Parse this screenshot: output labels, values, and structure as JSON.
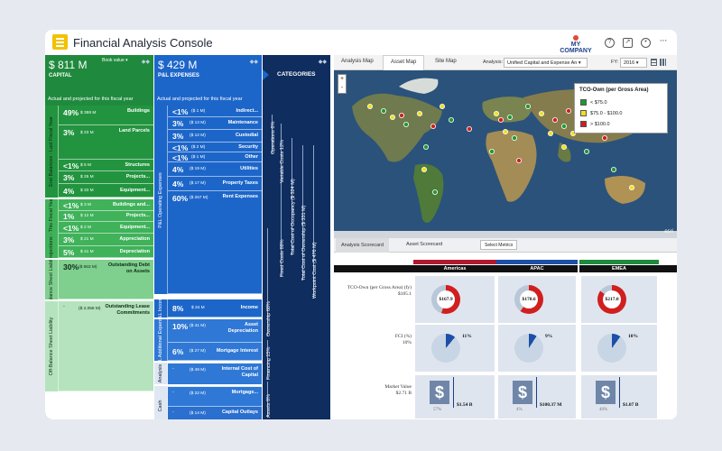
{
  "app": {
    "title": "Financial Analysis Console",
    "company": "MY COMPANY",
    "company_sub": "INTERNATIONAL"
  },
  "capital": {
    "value": "$ 811 M",
    "label": "CAPITAL",
    "menu": "Book value ▾",
    "note": "Actual and projected for this fiscal year",
    "sections": [
      {
        "label": "End Balances - Last Fiscal Year",
        "color": "#22943f",
        "rows": [
          {
            "pct": "49%",
            "amt": "$ 398 M",
            "label": "Buildings"
          },
          {
            "pct": "3%",
            "amt": "$ 23 M",
            "label": "Land Parcels"
          },
          {
            "pct": "<1%",
            "amt": "$ 5 M",
            "label": "Structures"
          },
          {
            "pct": "3%",
            "amt": "$ 25 M",
            "label": "Projects..."
          },
          {
            "pct": "4%",
            "amt": "$ 33 M",
            "label": "Equipment..."
          }
        ]
      },
      {
        "label": "Projections - This Fiscal Year",
        "color": "#3fb25a",
        "rows": [
          {
            "pct": "<1%",
            "amt": "$ 3 M",
            "label": "Buildings and..."
          },
          {
            "pct": "1%",
            "amt": "$ 12 M",
            "label": "Projects..."
          },
          {
            "pct": "<1%",
            "amt": "$ 2 M",
            "label": "Equipment..."
          },
          {
            "pct": "3%",
            "amt": "$ 21 M",
            "label": "Appreciation"
          },
          {
            "pct": "5%",
            "amt": "$ 41 M",
            "label": "Depreciation"
          }
        ]
      },
      {
        "label": "Balance Sheet Liability",
        "color": "#7fcf8e",
        "rows": [
          {
            "pct": "30%",
            "amt": "($ 663 M)",
            "label": "Outstanding Debt on Assets"
          }
        ]
      },
      {
        "label": "Off-Balance Sheet Liability",
        "color": "#b5e3bd",
        "rows": [
          {
            "pct": "-",
            "amt": "($ 2,056 M)",
            "label": "Outstanding Lease Commitments"
          }
        ]
      }
    ]
  },
  "pl": {
    "value": "$ 429 M",
    "label": "P&L EXPENSES",
    "note": "Actual and projected for this fiscal year",
    "sections": [
      {
        "label": "P&L Operating Expenses",
        "rows": [
          {
            "pct": "<1%",
            "amt": "($ 1 M)",
            "label": "Indirect..."
          },
          {
            "pct": "3%",
            "amt": "($ 13 M)",
            "label": "Maintenance"
          },
          {
            "pct": "3%",
            "amt": "($ 12 M)",
            "label": "Custodial"
          },
          {
            "pct": "<1%",
            "amt": "($ 2 M)",
            "label": "Security"
          },
          {
            "pct": "<1%",
            "amt": "($ 1 M)",
            "label": "Other"
          },
          {
            "pct": "4%",
            "amt": "($ 19 M)",
            "label": "Utilities"
          },
          {
            "pct": "4%",
            "amt": "($ 17 M)",
            "label": "Property Taxes"
          },
          {
            "pct": "60%",
            "amt": "($ 257 M)",
            "label": "Rent Expenses"
          }
        ]
      },
      {
        "label": "P&L Income",
        "rows": [
          {
            "pct": "8%",
            "amt": "$ 34 M",
            "label": "Income"
          }
        ]
      },
      {
        "label": "P&L Additional Expenses",
        "rows": [
          {
            "pct": "10%",
            "amt": "($ 41 M)",
            "label": "Asset Depreciation"
          },
          {
            "pct": "6%",
            "amt": "($ 27 M)",
            "label": "Mortgage Interest"
          }
        ]
      },
      {
        "label": "Analysis",
        "rows": [
          {
            "pct": "-",
            "amt": "($ 49 M)",
            "label": "Internal Cost of Capital"
          }
        ]
      },
      {
        "label": "Cash",
        "rows": [
          {
            "pct": "-",
            "amt": "($ 22 M)",
            "label": "Mortgage..."
          },
          {
            "pct": "-",
            "amt": "($ 14 M)",
            "label": "Capital Outlays"
          }
        ]
      }
    ]
  },
  "categories": {
    "title": "CATEGORIES",
    "bars": [
      "Operations 6%",
      "Variable Costs 12%",
      "Fixed Costs 88%",
      "Ownership 68%",
      "Total Cost of Occupancy ($ 324 M)",
      "Total Cost of Ownership ($ 331 M)",
      "Workpoint Cost ($ 476 M)",
      "Financing 15%",
      "Assets 8%"
    ]
  },
  "map": {
    "tabs": [
      "Analysis Map",
      "Asset Map",
      "Site Map"
    ],
    "analysis_label": "Analysis:",
    "analysis_value": "Unified Capital and Expense An ▾",
    "fy_label": "FY:",
    "fy_value": "2016 ▾",
    "legend_title": "TCO-Own (per Gross Area)",
    "legend": [
      {
        "label": "< $75.0",
        "color": "#1e9a2e"
      },
      {
        "label": "$75.0 - $100.0",
        "color": "#f0e020"
      },
      {
        "label": "> $100.0",
        "color": "#d11f1f"
      }
    ],
    "zoom": [
      "+",
      "-"
    ],
    "esri": "esri"
  },
  "scorecard": {
    "tabs": [
      "Analysis Scorecard",
      "Asset Scorecard"
    ],
    "select_metrics": "Select Metrics",
    "regions": [
      {
        "name": "Americas",
        "color": "#b0192e"
      },
      {
        "name": "APAC",
        "color": "#1c4fa8"
      },
      {
        "name": "EMEA",
        "color": "#1e8a3c"
      }
    ],
    "metrics": [
      {
        "name": "TCO-Own (per Gross Area) (fy)",
        "value": "$185.1"
      },
      {
        "name": "FCI (%)",
        "value": "10%"
      },
      {
        "name": "Market Value",
        "value": "$2.71 B"
      }
    ],
    "tco": [
      {
        "value": "$167.9",
        "red_fraction": 0.55
      },
      {
        "value": "$170.6",
        "red_fraction": 0.6
      },
      {
        "value": "$217.0",
        "red_fraction": 0.85
      }
    ],
    "fci": [
      {
        "value": "11%",
        "fraction": 0.11
      },
      {
        "value": "9%",
        "fraction": 0.09
      },
      {
        "value": "10%",
        "fraction": 0.1
      }
    ],
    "market": [
      {
        "pct": "57%",
        "value": "$1.54 B"
      },
      {
        "pct": "4%",
        "value": "$100.37 M"
      },
      {
        "pct": "40%",
        "value": "$1.07 B"
      }
    ]
  }
}
